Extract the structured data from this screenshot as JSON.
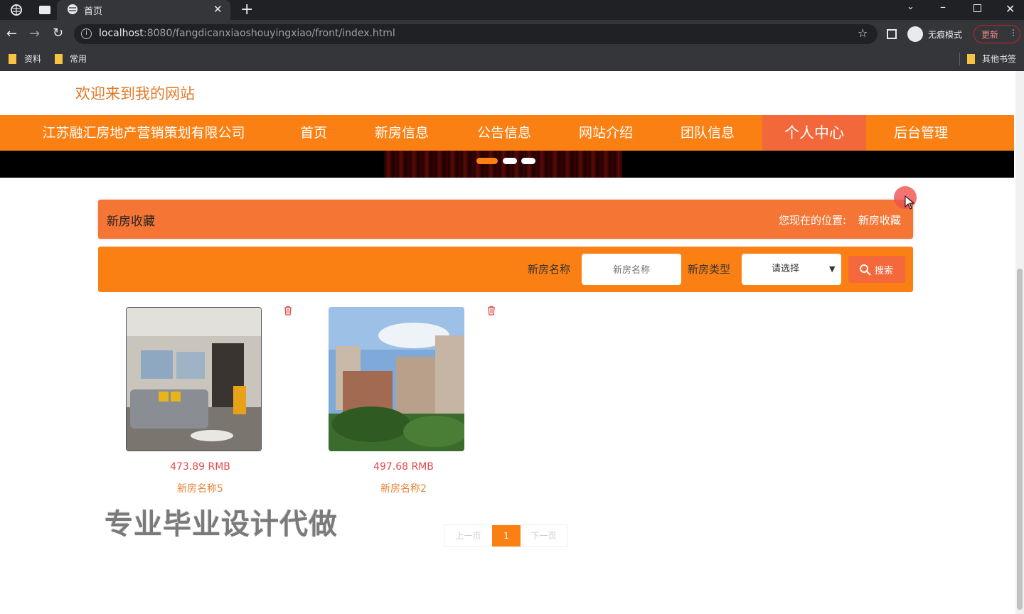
{
  "browser": {
    "tab_title": "首页",
    "url_host": "localhost",
    "url_path": ":8080/fangdicanxiaoshouyingxiao/front/index.html",
    "profile_label": "无痕模式",
    "update_label": "更新",
    "bookmarks": [
      "资料",
      "常用"
    ],
    "other_bookmarks": "其他书签"
  },
  "site": {
    "welcome": "欢迎来到我的网站",
    "company": "江苏融汇房地产营销策划有限公司",
    "nav": [
      "首页",
      "新房信息",
      "公告信息",
      "网站介绍",
      "团队信息",
      "个人中心",
      "后台管理"
    ],
    "active_nav": "个人中心"
  },
  "breadcrumb": {
    "title": "新房收藏",
    "location_label": "您现在的位置:",
    "location_value": "新房收藏"
  },
  "search": {
    "name_label": "新房名称",
    "name_placeholder": "新房名称",
    "type_label": "新房类型",
    "type_selected": "请选择",
    "button_label": "搜索"
  },
  "items": [
    {
      "price": "473.89 RMB",
      "name": "新房名称5"
    },
    {
      "price": "497.68 RMB",
      "name": "新房名称2"
    }
  ],
  "pager": {
    "prev": "上一页",
    "current": "1",
    "next": "下一页"
  },
  "watermark": "专业毕业设计代做"
}
